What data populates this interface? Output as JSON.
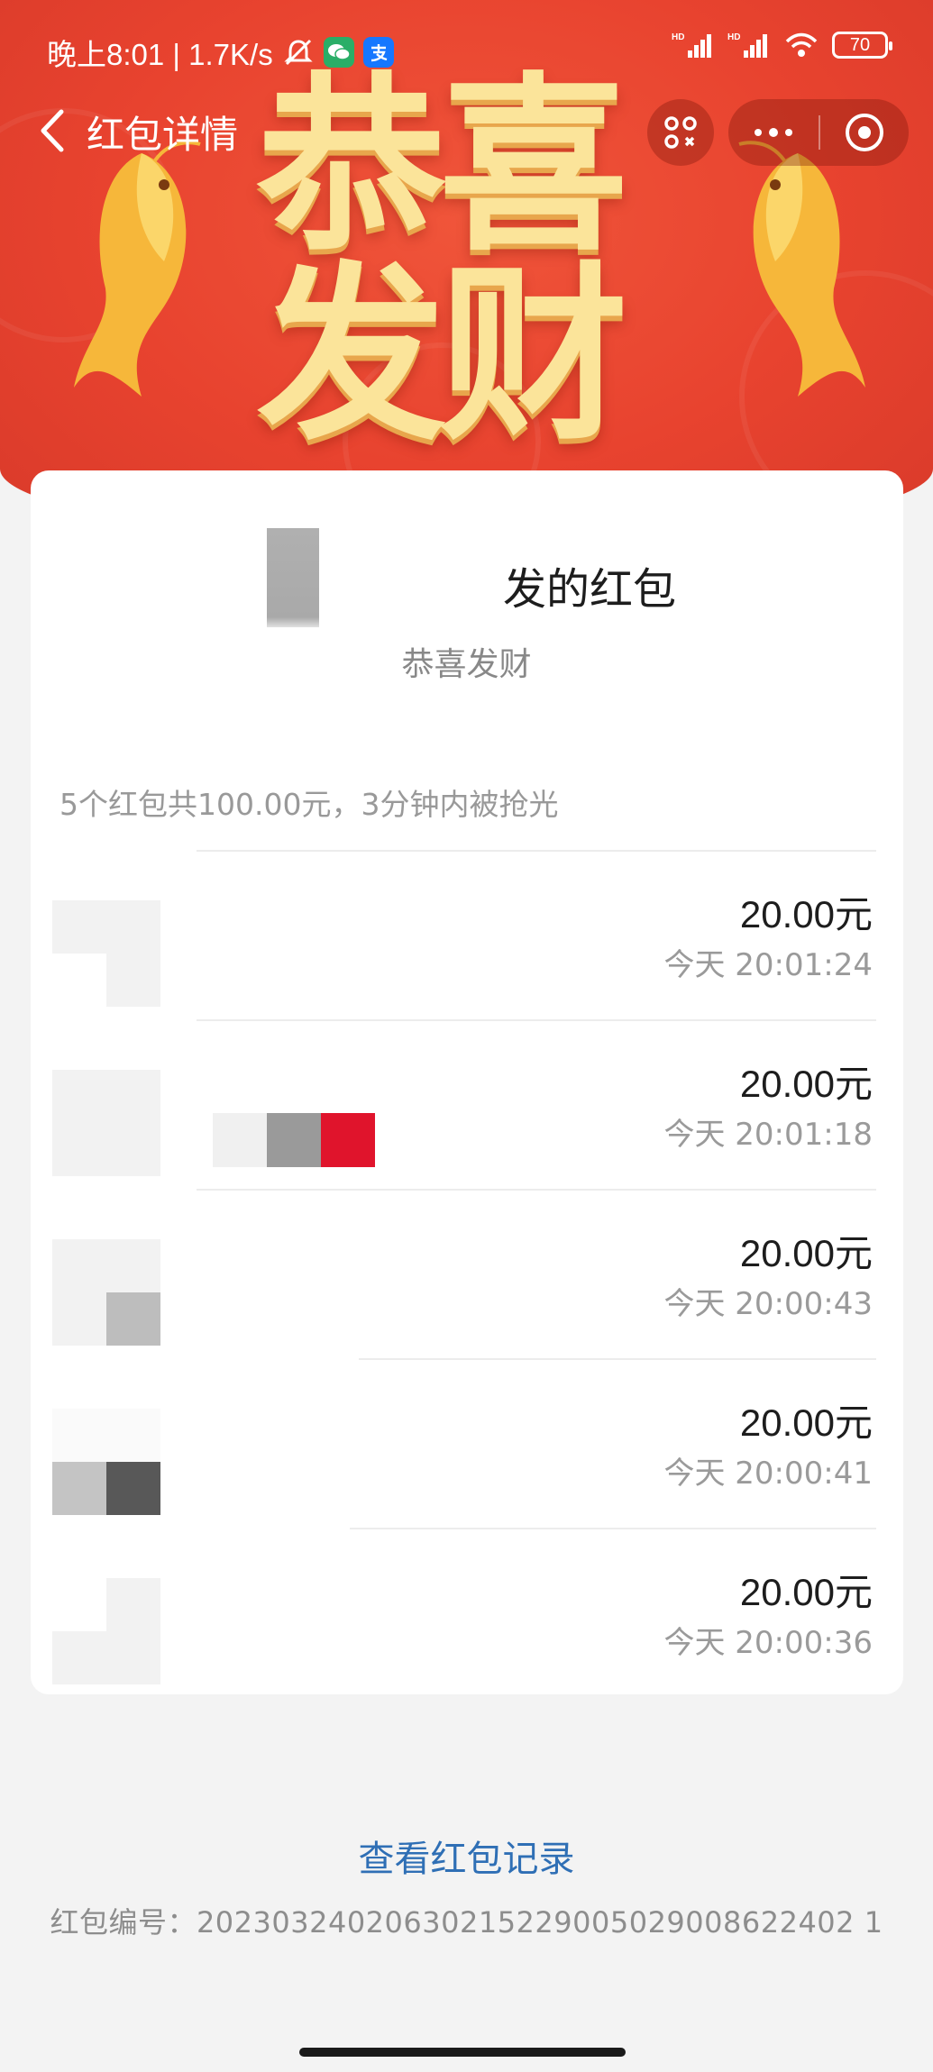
{
  "status_bar": {
    "left_text": "晚上8:01 | 1.7K/s",
    "battery": "70"
  },
  "nav": {
    "title": "红包详情"
  },
  "banner": {
    "title": "恭喜\n发财"
  },
  "packet": {
    "sender_label": "发的红包",
    "wish": "恭喜发财",
    "summary": "5个红包共100.00元，3分钟内被抢光"
  },
  "receivers": [
    {
      "amount": "20.00元",
      "time": "今天 20:01:24"
    },
    {
      "amount": "20.00元",
      "time": "今天 20:01:18"
    },
    {
      "amount": "20.00元",
      "time": "今天 20:00:43"
    },
    {
      "amount": "20.00元",
      "time": "今天 20:00:41"
    },
    {
      "amount": "20.00元",
      "time": "今天 20:00:36"
    }
  ],
  "footer": {
    "link": "查看红包记录",
    "serial": "红包编号：20230324020630215229005029008622402 1"
  },
  "colors": {
    "banner_red": "#e8432f",
    "gold_text": "#fbe49a",
    "link_blue": "#2f6fb5"
  }
}
